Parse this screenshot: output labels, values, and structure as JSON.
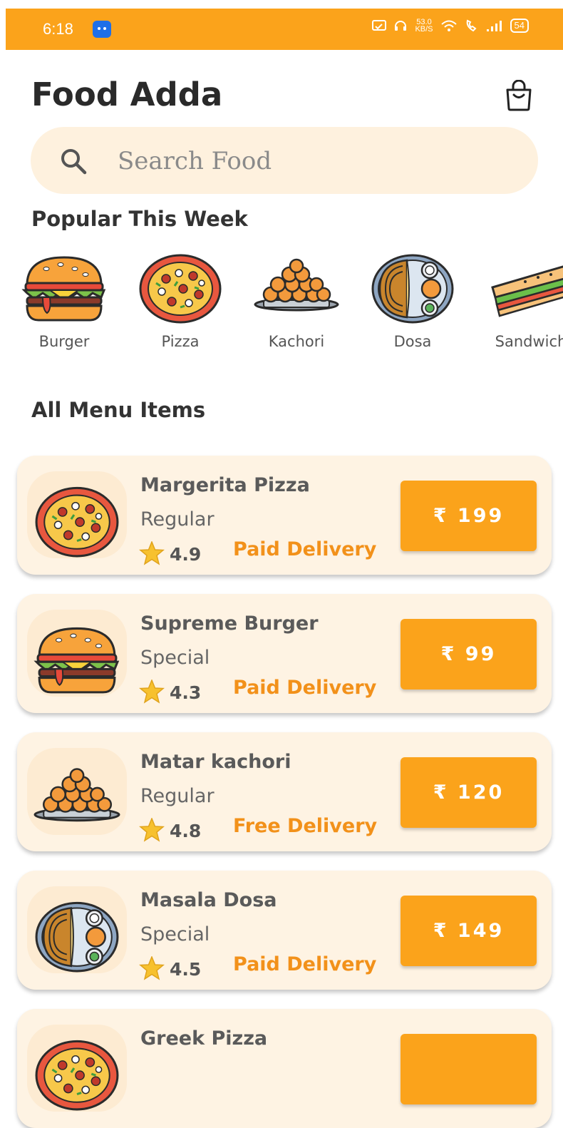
{
  "status_bar": {
    "time": "6:18",
    "speed_top": "53.0",
    "speed_bottom": "KB/S",
    "battery": "54"
  },
  "header": {
    "title": "Food Adda",
    "bag_icon": "shopping-bag-icon"
  },
  "search": {
    "placeholder": "Search Food",
    "icon": "search-icon"
  },
  "popular": {
    "heading": "Popular This Week",
    "items": [
      {
        "label": "Burger",
        "icon": "burger-icon"
      },
      {
        "label": "Pizza",
        "icon": "pizza-icon"
      },
      {
        "label": "Kachori",
        "icon": "kachori-icon"
      },
      {
        "label": "Dosa",
        "icon": "dosa-icon"
      },
      {
        "label": "Sandwich",
        "icon": "sandwich-icon"
      }
    ]
  },
  "menu": {
    "heading": "All Menu Items",
    "items": [
      {
        "name": "Margerita Pizza",
        "type": "Regular",
        "rating": "4.9",
        "delivery": "Paid Delivery",
        "price": "₹ 199",
        "icon": "pizza-icon"
      },
      {
        "name": "Supreme Burger",
        "type": "Special",
        "rating": "4.3",
        "delivery": "Paid Delivery",
        "price": "₹ 99",
        "icon": "burger-icon"
      },
      {
        "name": "Matar kachori",
        "type": "Regular",
        "rating": "4.8",
        "delivery": "Free Delivery",
        "price": "₹ 120",
        "icon": "kachori-icon"
      },
      {
        "name": "Masala Dosa",
        "type": "Special",
        "rating": "4.5",
        "delivery": "Paid Delivery",
        "price": "₹ 149",
        "icon": "dosa-icon"
      },
      {
        "name": "Greek Pizza",
        "type": "",
        "rating": "",
        "delivery": "",
        "price": "",
        "icon": "pizza-icon"
      }
    ]
  },
  "colors": {
    "accent": "#FBA31B",
    "card_bg": "#FEF3E3",
    "delivery_text": "#F2911A"
  }
}
